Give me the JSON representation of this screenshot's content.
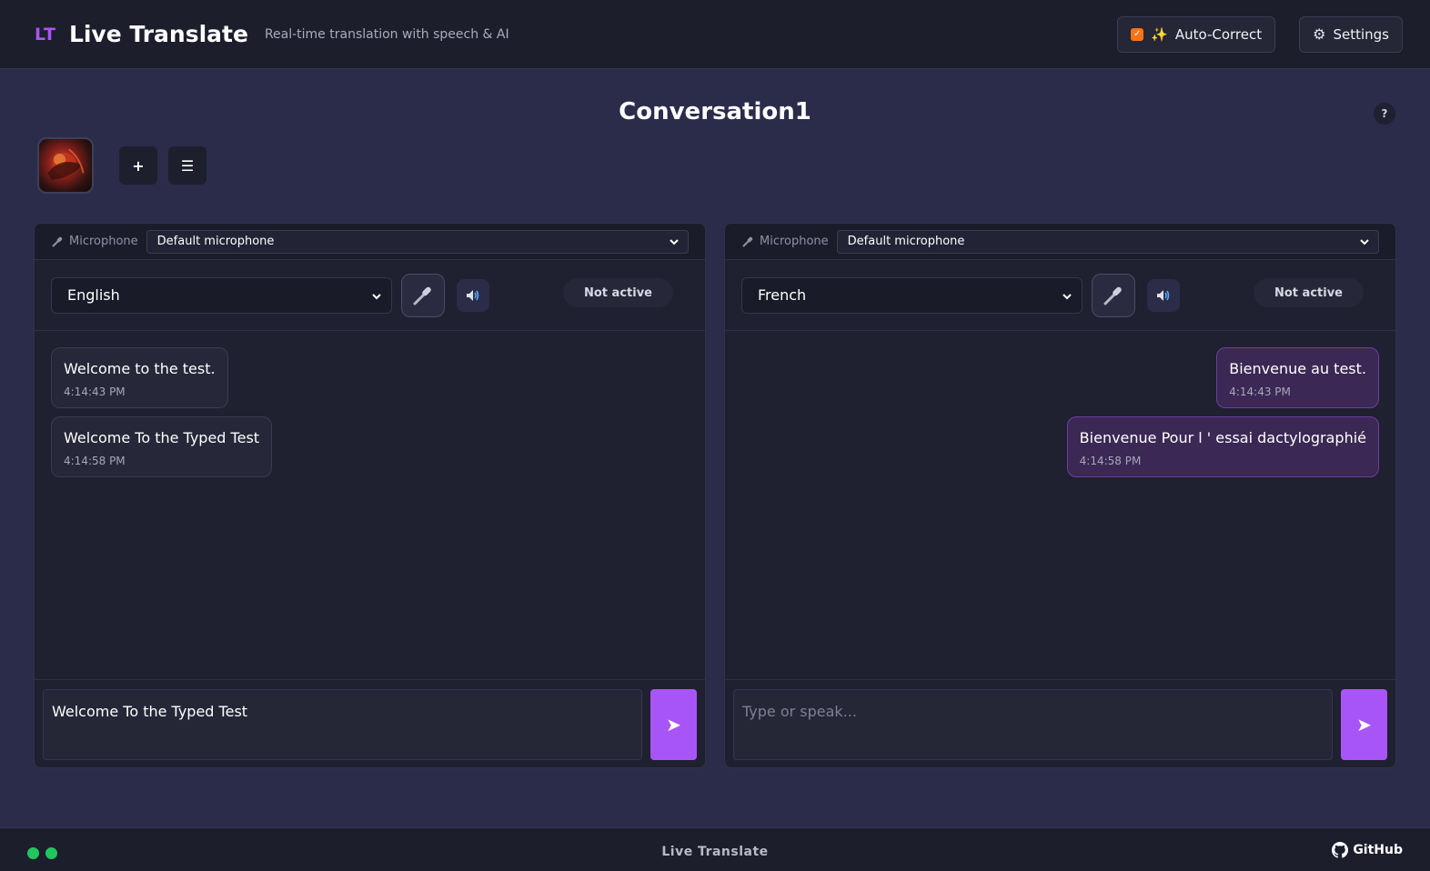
{
  "header": {
    "logo_mark": "LT",
    "title": "Live Translate",
    "subtitle": "Real-time translation with speech & AI",
    "autocorrect_label": "Auto-Correct",
    "settings_label": "Settings"
  },
  "conversation": {
    "title": "Conversation1",
    "help_label": "?",
    "add_label": "+",
    "menu_label": "☰"
  },
  "left_panel": {
    "mic_label": "Microphone",
    "mic_value": "Default microphone",
    "language": "English",
    "status": "Not active",
    "messages": [
      {
        "text": "Welcome to the test.",
        "time": "4:14:43 PM"
      },
      {
        "text": "Welcome To the Typed Test",
        "time": "4:14:58 PM"
      }
    ],
    "input_value": "Welcome To the Typed Test",
    "input_placeholder": "Type or speak..."
  },
  "right_panel": {
    "mic_label": "Microphone",
    "mic_value": "Default microphone",
    "language": "French",
    "status": "Not active",
    "messages": [
      {
        "text": "Bienvenue au test.",
        "time": "4:14:43 PM"
      },
      {
        "text": "Bienvenue Pour l ' essai dactylographié",
        "time": "4:14:58 PM"
      }
    ],
    "input_value": "",
    "input_placeholder": "Type or speak..."
  },
  "footer": {
    "title": "Live Translate",
    "github_label": "GitHub"
  },
  "colors": {
    "accent": "#a855f7",
    "status_dot": "#22c55e",
    "checkbox": "#f97316"
  }
}
